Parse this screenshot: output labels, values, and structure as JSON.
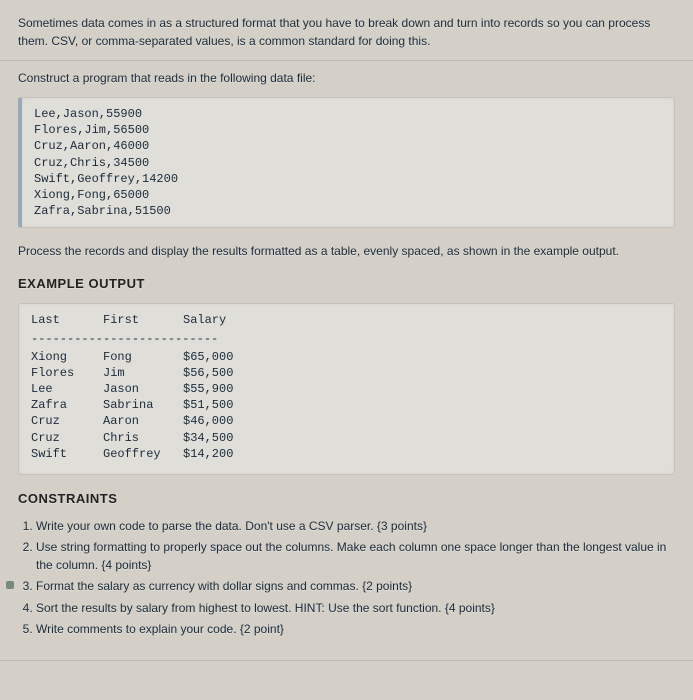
{
  "intro": "Sometimes data comes in as a structured format that you have to break down and turn into records so you can process them. CSV, or comma-separated values, is a common standard for doing this.",
  "prompt": "Construct a program that reads in the following data file:",
  "datafile": [
    "Lee,Jason,55900",
    "Flores,Jim,56500",
    "Cruz,Aaron,46000",
    "Cruz,Chris,34500",
    "Swift,Geoffrey,14200",
    "Xiong,Fong,65000",
    "Zafra,Sabrina,51500"
  ],
  "process_text": "Process the records and display the results formatted as a table, evenly spaced, as shown in the example output.",
  "example_heading": "EXAMPLE OUTPUT",
  "table": {
    "headers": {
      "last": "Last",
      "first": "First",
      "salary": "Salary"
    },
    "dashes": "--------------------------",
    "rows": [
      {
        "last": "Xiong",
        "first": "Fong",
        "salary": "$65,000"
      },
      {
        "last": "Flores",
        "first": "Jim",
        "salary": "$56,500"
      },
      {
        "last": "Lee",
        "first": "Jason",
        "salary": "$55,900"
      },
      {
        "last": "Zafra",
        "first": "Sabrina",
        "salary": "$51,500"
      },
      {
        "last": "Cruz",
        "first": "Aaron",
        "salary": "$46,000"
      },
      {
        "last": "Cruz",
        "first": "Chris",
        "salary": "$34,500"
      },
      {
        "last": "Swift",
        "first": "Geoffrey",
        "salary": "$14,200"
      }
    ]
  },
  "constraints_heading": "CONSTRAINTS",
  "constraints": [
    "Write your own code to parse the data. Don't use a CSV parser. {3 points}",
    "Use string formatting to properly space out the columns. Make each column one space longer than the longest value in the column. {4 points}",
    "Format the salary as currency with dollar signs and commas. {2 points}",
    "Sort the results by salary from highest to lowest. HINT: Use the sort function. {4 points}",
    "Write comments to explain your code. {2 point}"
  ]
}
